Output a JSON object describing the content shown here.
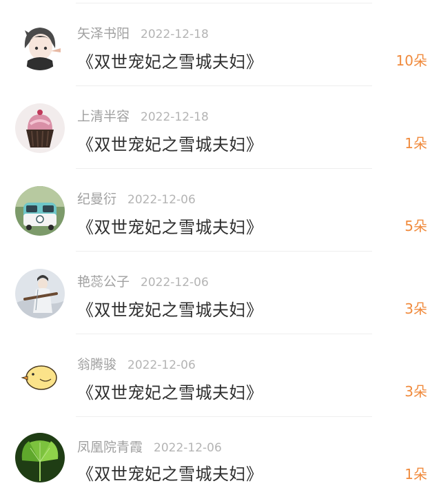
{
  "gift_list": {
    "rows": [
      {
        "user": "矢泽书阳",
        "date": "2022-12-18",
        "book": "《双世宠妃之雪城夫妇》",
        "flowers": "10朵",
        "avatar": "anime-girl-avatar"
      },
      {
        "user": "上清半容",
        "date": "2022-12-18",
        "book": "《双世宠妃之雪城夫妇》",
        "flowers": "1朵",
        "avatar": "cupcake-avatar"
      },
      {
        "user": "纪曼衍",
        "date": "2022-12-06",
        "book": "《双世宠妃之雪城夫妇》",
        "flowers": "5朵",
        "avatar": "vw-bus-avatar"
      },
      {
        "user": "艳蕊公子",
        "date": "2022-12-06",
        "book": "《双世宠妃之雪城夫妇》",
        "flowers": "3朵",
        "avatar": "guqin-scholar-avatar"
      },
      {
        "user": "翁腾骏",
        "date": "2022-12-06",
        "book": "《双世宠妃之雪城夫妇》",
        "flowers": "3朵",
        "avatar": "yellow-chick-avatar"
      },
      {
        "user": "凤凰院青霞",
        "date": "2022-12-06",
        "book": "《双世宠妃之雪城夫妇》",
        "flowers": "1朵",
        "avatar": "ginkgo-leaf-avatar"
      }
    ]
  },
  "colors": {
    "flower_count": "#f08a3c",
    "username": "#a0a0a0",
    "title": "#2e2e2e"
  }
}
